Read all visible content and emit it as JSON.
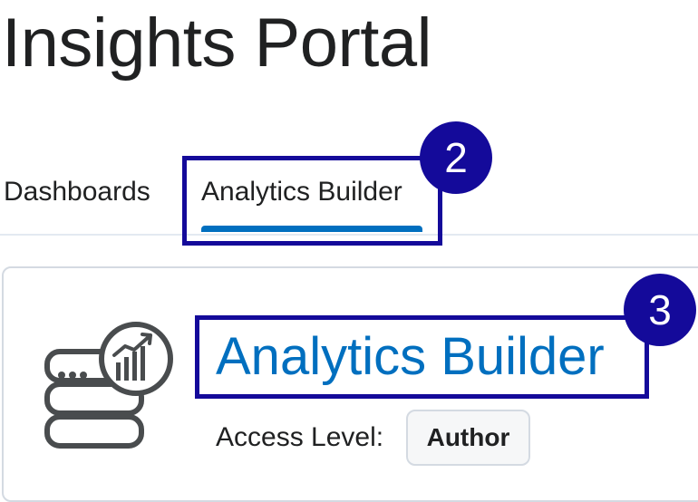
{
  "page": {
    "title": "Insights Portal"
  },
  "tabs": [
    {
      "label": "Dashboards",
      "selected": false
    },
    {
      "label": "Analytics Builder",
      "selected": true
    }
  ],
  "callouts": [
    {
      "number": "2"
    },
    {
      "number": "3"
    }
  ],
  "card": {
    "icon": "database-analytics-icon",
    "title": "Analytics Builder",
    "access_label": "Access Level:",
    "access_value": "Author"
  },
  "colors": {
    "accent": "#006fbf",
    "callout": "#140a9a",
    "text": "#202122",
    "border": "#d4dae2"
  }
}
